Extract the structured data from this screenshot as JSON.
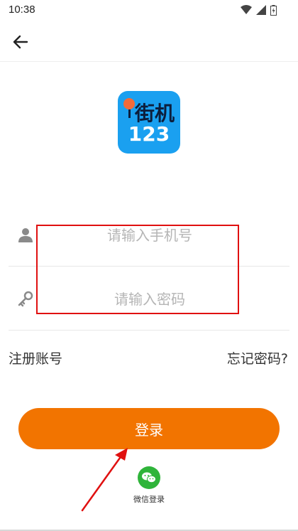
{
  "status_bar": {
    "time": "10:38"
  },
  "logo": {
    "line1": "街机",
    "line2": "123"
  },
  "form": {
    "phone_placeholder": "请输入手机号",
    "password_placeholder": "请输入密码"
  },
  "links": {
    "register": "注册账号",
    "forgot": "忘记密码?"
  },
  "login_button": "登录",
  "wechat_login": "微信登录",
  "colors": {
    "accent": "#f27400",
    "logo_bg": "#1aa0f0",
    "wechat": "#2fb43a",
    "annotation": "#e01010"
  }
}
